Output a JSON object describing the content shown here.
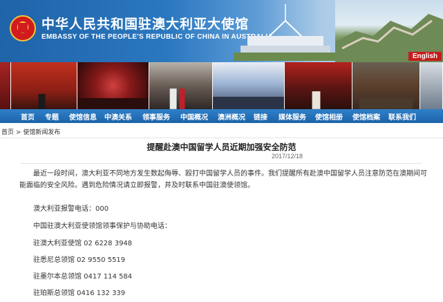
{
  "header": {
    "title_cn": "中华人民共和国驻澳大利亚大使馆",
    "title_en": "EMBASSY OF THE PEOPLE'S REPUBLIC OF CHINA IN AUSTRALIA",
    "language_button": "English",
    "emblem_icon": "national-emblem-icon"
  },
  "nav": {
    "items": [
      "首页",
      "专题",
      "使馆信息",
      "中澳关系",
      "领事服务",
      "中国概况",
      "澳洲概况",
      "链接",
      "媒体服务",
      "使馆相册",
      "使馆档案",
      "联系我们"
    ]
  },
  "breadcrumb": {
    "home": "首页",
    "separator": ">",
    "section": "使馆新闻发布"
  },
  "article": {
    "title": "提醒赴澳中国留学人员近期加强安全防范",
    "date": "2017/12/18",
    "paragraph": "最近一段时间，澳大利亚不同地方发生数起侮辱、殴打中国留学人员的事件。我们提醒所有赴澳中国留学人员注意防范在澳期间可能面临的安全风险。遇到危险情况请立即报警，并及时联系中国驻澳使领馆。",
    "police_line": "澳大利亚报警电话：000",
    "consular_heading": "中国驻澳大利亚使领馆领事保护与协助电话：",
    "contacts": [
      "驻澳大利亚使馆 02 6228 3948",
      "驻悉尼总领馆 02 9550 5519",
      "驻墨尔本总领馆 0417 114 584",
      "驻珀斯总领馆 0416 132 339"
    ]
  },
  "colors": {
    "nav_bg": "#1c63a9",
    "banner_blue": "#2b78c0",
    "english_button": "#c61b1b"
  }
}
